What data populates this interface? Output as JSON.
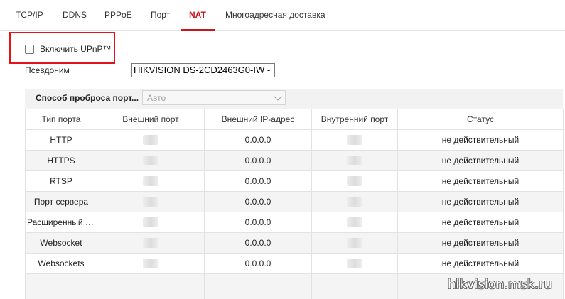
{
  "tabs": [
    {
      "label": "TCP/IP"
    },
    {
      "label": "DDNS"
    },
    {
      "label": "PPPoE"
    },
    {
      "label": "Порт"
    },
    {
      "label": "NAT",
      "active": true
    },
    {
      "label": "Многоадресная доставка"
    }
  ],
  "upnp": {
    "label": "Включить UPnP™",
    "checked": false
  },
  "alias": {
    "label": "Псевдоним",
    "value": "HIKVISION DS-2CD2463G0-IW -"
  },
  "mapping": {
    "label": "Способ проброса порт...",
    "value": "Авто"
  },
  "table": {
    "headers": [
      "Тип порта",
      "Внешний порт",
      "Внешний IP-адрес",
      "Внутренний порт",
      "Статус"
    ],
    "rows": [
      {
        "type": "HTTP",
        "external_ip": "0.0.0.0",
        "status": "не действительный"
      },
      {
        "type": "HTTPS",
        "external_ip": "0.0.0.0",
        "status": "не действительный"
      },
      {
        "type": "RTSP",
        "external_ip": "0.0.0.0",
        "status": "не действительный"
      },
      {
        "type": "Порт сервера",
        "external_ip": "0.0.0.0",
        "status": "не действительный"
      },
      {
        "type": "Расширенный с...",
        "external_ip": "0.0.0.0",
        "status": "не действительный"
      },
      {
        "type": "Websocket",
        "external_ip": "0.0.0.0",
        "status": "не действительный"
      },
      {
        "type": "Websockets",
        "external_ip": "0.0.0.0",
        "status": "не действительный"
      }
    ]
  },
  "watermark": "hikvision.msk.ru",
  "colors": {
    "accent": "#c8161d",
    "highlight_box": "#e3131b"
  }
}
